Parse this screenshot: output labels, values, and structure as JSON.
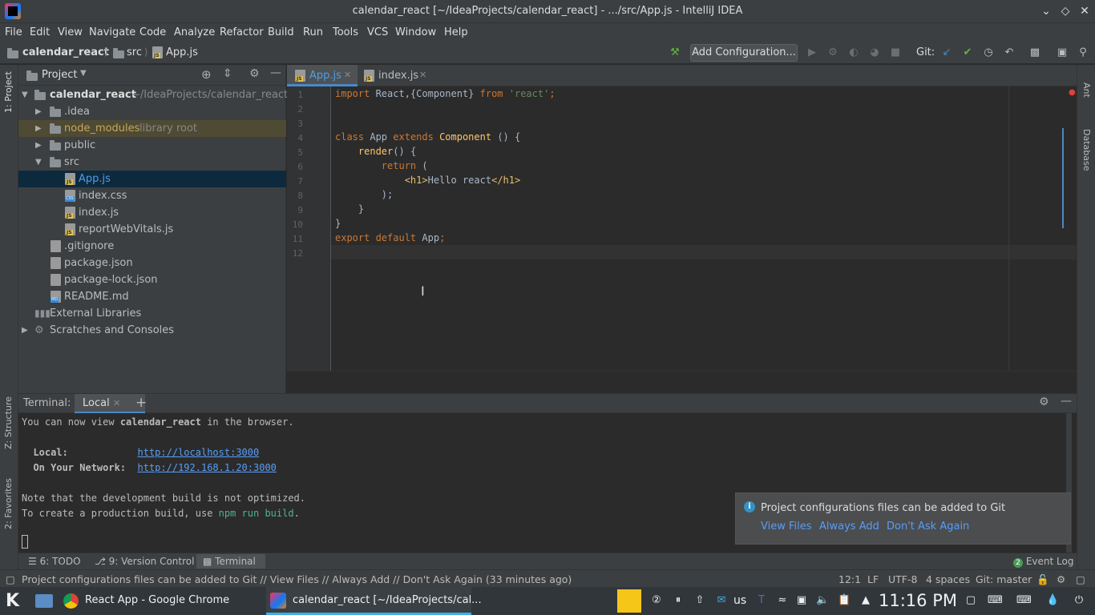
{
  "window": {
    "title": "calendar_react [~/IdeaProjects/calendar_react] - .../src/App.js - IntelliJ IDEA"
  },
  "menu": [
    "File",
    "Edit",
    "View",
    "Navigate",
    "Code",
    "Analyze",
    "Refactor",
    "Build",
    "Run",
    "Tools",
    "VCS",
    "Window",
    "Help"
  ],
  "breadcrumb": [
    "calendar_react",
    "src",
    "App.js"
  ],
  "toolbar": {
    "add_configuration": "Add Configuration...",
    "git_label": "Git:"
  },
  "project_panel": {
    "title": "Project",
    "root_name": "calendar_react",
    "root_path": "~/IdeaProjects/calendar_react",
    "items": [
      {
        "label": ".idea",
        "hint": ""
      },
      {
        "label": "node_modules",
        "hint": "library root"
      },
      {
        "label": "public",
        "hint": ""
      },
      {
        "label": "src",
        "hint": ""
      },
      {
        "label": "App.js",
        "hint": ""
      },
      {
        "label": "index.css",
        "hint": ""
      },
      {
        "label": "index.js",
        "hint": ""
      },
      {
        "label": "reportWebVitals.js",
        "hint": ""
      },
      {
        "label": ".gitignore",
        "hint": ""
      },
      {
        "label": "package.json",
        "hint": ""
      },
      {
        "label": "package-lock.json",
        "hint": ""
      },
      {
        "label": "README.md",
        "hint": ""
      },
      {
        "label": "External Libraries",
        "hint": ""
      },
      {
        "label": "Scratches and Consoles",
        "hint": ""
      }
    ]
  },
  "editor_tabs": [
    {
      "label": "App.js",
      "active": true
    },
    {
      "label": "index.js",
      "active": false
    }
  ],
  "code_lines": [
    {
      "n": "1",
      "parts": [
        [
          "kw",
          "import "
        ],
        [
          "",
          "React,{Component} "
        ],
        [
          "kw",
          "from "
        ],
        [
          "str",
          "'react'"
        ],
        [
          "kw",
          ";"
        ]
      ]
    },
    {
      "n": "2",
      "parts": []
    },
    {
      "n": "3",
      "parts": []
    },
    {
      "n": "4",
      "parts": [
        [
          "kw",
          "class "
        ],
        [
          "",
          "App "
        ],
        [
          "kw",
          "extends "
        ],
        [
          "cls",
          "Component "
        ],
        [
          "",
          "() {"
        ]
      ]
    },
    {
      "n": "5",
      "parts": [
        [
          "",
          "    "
        ],
        [
          "cls",
          "render"
        ],
        [
          "",
          "() {"
        ]
      ]
    },
    {
      "n": "6",
      "parts": [
        [
          "",
          "        "
        ],
        [
          "kw",
          "return "
        ],
        [
          "",
          "("
        ]
      ]
    },
    {
      "n": "7",
      "parts": [
        [
          "",
          "            "
        ],
        [
          "tag",
          "<h1>"
        ],
        [
          "",
          "Hello react"
        ],
        [
          "tag",
          "</h1>"
        ]
      ]
    },
    {
      "n": "8",
      "parts": [
        [
          "",
          "        );"
        ]
      ]
    },
    {
      "n": "9",
      "parts": [
        [
          "",
          "    }"
        ]
      ]
    },
    {
      "n": "10",
      "parts": [
        [
          "",
          "}"
        ]
      ]
    },
    {
      "n": "11",
      "parts": [
        [
          "kw",
          "export default "
        ],
        [
          "",
          "App"
        ],
        [
          "kw",
          ";"
        ]
      ]
    },
    {
      "n": "12",
      "parts": []
    }
  ],
  "terminal": {
    "title": "Terminal:",
    "tab": "Local",
    "line1_prefix": "You can now view ",
    "line1_app": "calendar_react",
    "line1_suffix": " in the browser.",
    "local_label": "  Local:            ",
    "local_url": "http://localhost:3000",
    "network_label": "  On Your Network:  ",
    "network_url": "http://192.168.1.20:3000",
    "note1": "Note that the development build is not optimized.",
    "note2_prefix": "To create a production build, use ",
    "note2_cmd": "npm run build",
    "note2_suffix": "."
  },
  "notification": {
    "message": "Project configurations files can be added to Git",
    "actions": [
      "View Files",
      "Always Add",
      "Don't Ask Again"
    ]
  },
  "bottom_tabs": {
    "todo": "6: TODO",
    "vcs": "9: Version Control",
    "terminal": "Terminal",
    "event_log": "Event Log",
    "event_count": "2"
  },
  "side_labels": {
    "project": "1: Project",
    "structure": "Z: Structure",
    "favorites": "2: Favorites",
    "ant": "Ant",
    "database": "Database"
  },
  "status": {
    "message": "Project configurations files can be added to Git // View Files // Always Add // Don't Ask Again (33 minutes ago)",
    "position": "12:1",
    "line_sep": "LF",
    "encoding": "UTF-8",
    "indent": "4 spaces",
    "git": "Git: master"
  },
  "taskbar": {
    "chrome_task": "React App - Google Chrome",
    "idea_task": "calendar_react [~/IdeaProjects/cal...",
    "keyboard": "us",
    "clock": "11:16 PM"
  },
  "colors": {
    "accent": "#4a88c7",
    "selection": "#0d293e",
    "link": "#589df6"
  }
}
